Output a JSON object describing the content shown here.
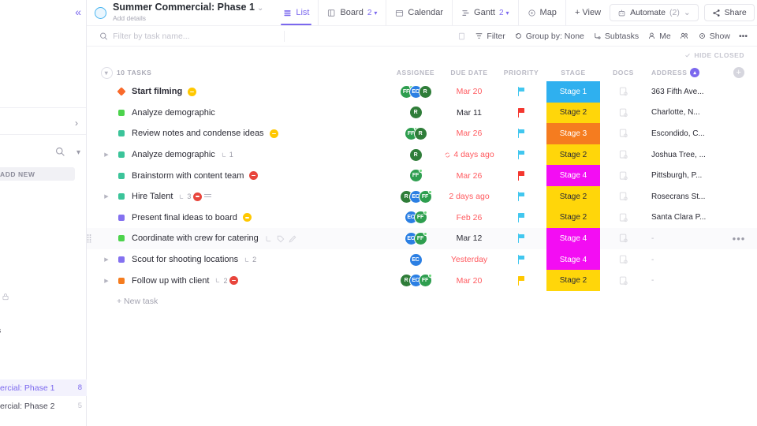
{
  "sidebar": {
    "collapse_icon": "double-chevron-left-icon",
    "expand_icon": "chevron-right-icon",
    "search_icon": "search-icon",
    "caret_icon": "chevron-down-icon",
    "add_new_label": "ADD NEW",
    "lock_icon": "lock-icon",
    "ghost_items": [
      {
        "label": "s"
      },
      {
        "label": "·"
      },
      {
        "label": "·"
      }
    ],
    "projects": [
      {
        "label": "ercial: Phase 1",
        "count": "8",
        "selected": true
      },
      {
        "label": "ercial: Phase 2",
        "count": "5",
        "selected": false
      }
    ]
  },
  "header": {
    "project_icon": "circle-outline-icon",
    "title": "Summer Commercial: Phase 1",
    "title_caret": "⌄",
    "subtitle": "Add details",
    "tabs": [
      {
        "label": "List",
        "icon": "list-icon",
        "count": "",
        "active": true
      },
      {
        "label": "Board",
        "icon": "board-icon",
        "count": "2",
        "active": false
      },
      {
        "label": "Calendar",
        "icon": "calendar-icon",
        "count": "",
        "active": false
      },
      {
        "label": "Gantt",
        "icon": "gantt-icon",
        "count": "2",
        "active": false
      },
      {
        "label": "Map",
        "icon": "map-pin-icon",
        "count": "",
        "active": false
      },
      {
        "label": "+ View",
        "icon": "plus-icon",
        "count": "",
        "active": false
      }
    ],
    "automate": {
      "label": "Automate",
      "count": "(2)",
      "icon": "robot-icon",
      "caret": "⌄"
    },
    "share": {
      "label": "Share",
      "icon": "share-icon"
    }
  },
  "filterbar": {
    "search_icon": "search-icon",
    "search_placeholder": "Filter by task name...",
    "search_value": "",
    "items": [
      {
        "label": "",
        "icon": "page-icon",
        "muted": true
      },
      {
        "label": "Filter",
        "icon": "filter-icon",
        "muted": false
      },
      {
        "label": "Group by: None",
        "icon": "group-icon",
        "muted": false
      },
      {
        "label": "Subtasks",
        "icon": "subtask-icon",
        "muted": false
      },
      {
        "label": "Me",
        "icon": "person-icon",
        "muted": false
      },
      {
        "label": "",
        "icon": "people-icon",
        "muted": false
      },
      {
        "label": "Show",
        "icon": "eye-icon",
        "muted": false
      },
      {
        "label": "•••",
        "icon": "more-icon",
        "muted": false
      }
    ],
    "hide_closed": {
      "label": "HIDE CLOSED",
      "icon": "check-icon"
    }
  },
  "table": {
    "group_caret_icon": "chevron-down-icon",
    "tasks_count_label": "10 TASKS",
    "columns": [
      {
        "key": "assignee",
        "label": "ASSIGNEE"
      },
      {
        "key": "due",
        "label": "DUE DATE"
      },
      {
        "key": "priority",
        "label": "PRIORITY"
      },
      {
        "key": "stage",
        "label": "STAGE"
      },
      {
        "key": "docs",
        "label": "DOCS"
      },
      {
        "key": "address",
        "label": "ADDRESS"
      }
    ],
    "address_chip_icon": "caret-up-icon",
    "add_column_icon": "plus-circle-icon",
    "new_task_label": "+ New task",
    "rows": [
      {
        "name": "Start filming",
        "bold": true,
        "dot_color": "#f96a2b",
        "dot_shape": "diamond",
        "expandable": false,
        "badges": [
          {
            "type": "yellow"
          }
        ],
        "subtask_count": "",
        "avatars": [
          {
            "initials": "FF",
            "color": "#2e9e4f",
            "online": true
          },
          {
            "initials": "EC",
            "color": "#2b7fe3",
            "online": false
          },
          {
            "initials": "R",
            "color": "#2f7d39",
            "online": false
          }
        ],
        "due": "Mar 20",
        "due_overdue": true,
        "due_recurring": false,
        "priority": "#42c7ef",
        "stage": "Stage 1",
        "stage_color": "#2fb0ef",
        "stage_text_dark": false,
        "address": "363 Fifth Ave...",
        "hovered": false
      },
      {
        "name": "Analyze demographic",
        "bold": false,
        "dot_color": "#4cd34c",
        "dot_shape": "square",
        "expandable": false,
        "badges": [],
        "subtask_count": "",
        "avatars": [
          {
            "initials": "R",
            "color": "#2f7d39",
            "online": false
          }
        ],
        "due": "Mar 11",
        "due_overdue": false,
        "due_recurring": false,
        "priority": "#f4372f",
        "stage": "Stage 2",
        "stage_color": "#ffd60a",
        "stage_text_dark": true,
        "address": "Charlotte, N...",
        "hovered": false
      },
      {
        "name": "Review notes and condense ideas",
        "bold": false,
        "dot_color": "#3cc49a",
        "dot_shape": "square",
        "expandable": false,
        "badges": [
          {
            "type": "yellow"
          }
        ],
        "subtask_count": "",
        "avatars": [
          {
            "initials": "FF",
            "color": "#2e9e4f",
            "online": true
          },
          {
            "initials": "R",
            "color": "#2f7d39",
            "online": false
          }
        ],
        "due": "Mar 26",
        "due_overdue": true,
        "due_recurring": false,
        "priority": "#42c7ef",
        "stage": "Stage 3",
        "stage_color": "#f57c1f",
        "stage_text_dark": false,
        "address": "Escondido, C...",
        "hovered": false
      },
      {
        "name": "Analyze demographic",
        "bold": false,
        "dot_color": "#3cc49a",
        "dot_shape": "square",
        "expandable": true,
        "badges": [],
        "subtask_count": "1",
        "avatars": [
          {
            "initials": "R",
            "color": "#2f7d39",
            "online": false
          }
        ],
        "due": "4 days ago",
        "due_overdue": true,
        "due_recurring": true,
        "priority": "#42c7ef",
        "stage": "Stage 2",
        "stage_color": "#ffd60a",
        "stage_text_dark": true,
        "address": "Joshua Tree, ...",
        "hovered": false
      },
      {
        "name": "Brainstorm with content team",
        "bold": false,
        "dot_color": "#3cc49a",
        "dot_shape": "square",
        "expandable": false,
        "badges": [
          {
            "type": "red"
          }
        ],
        "subtask_count": "",
        "avatars": [
          {
            "initials": "FF",
            "color": "#2e9e4f",
            "online": true
          }
        ],
        "due": "Mar 26",
        "due_overdue": true,
        "due_recurring": false,
        "priority": "#f4372f",
        "stage": "Stage 4",
        "stage_color": "#f30df3",
        "stage_text_dark": false,
        "address": "Pittsburgh, P...",
        "hovered": false
      },
      {
        "name": "Hire Talent",
        "bold": false,
        "dot_color": "#3cc49a",
        "dot_shape": "square",
        "expandable": true,
        "badges": [
          {
            "type": "red"
          },
          {
            "type": "lines"
          }
        ],
        "subtask_count": "3",
        "avatars": [
          {
            "initials": "R",
            "color": "#2f7d39",
            "online": false
          },
          {
            "initials": "EC",
            "color": "#2b7fe3",
            "online": false
          },
          {
            "initials": "FF",
            "color": "#2e9e4f",
            "online": true
          }
        ],
        "due": "2 days ago",
        "due_overdue": true,
        "due_recurring": false,
        "priority": "#42c7ef",
        "stage": "Stage 2",
        "stage_color": "#ffd60a",
        "stage_text_dark": true,
        "address": "Rosecrans St...",
        "hovered": false
      },
      {
        "name": "Present final ideas to board",
        "bold": false,
        "dot_color": "#8471f0",
        "dot_shape": "square",
        "expandable": false,
        "badges": [
          {
            "type": "yellow"
          }
        ],
        "subtask_count": "",
        "avatars": [
          {
            "initials": "EC",
            "color": "#2b7fe3",
            "online": false
          },
          {
            "initials": "FF",
            "color": "#2e9e4f",
            "online": true
          }
        ],
        "due": "Feb 26",
        "due_overdue": true,
        "due_recurring": false,
        "priority": "#42c7ef",
        "stage": "Stage 2",
        "stage_color": "#ffd60a",
        "stage_text_dark": true,
        "address": "Santa Clara P...",
        "hovered": false
      },
      {
        "name": "Coordinate with crew for catering",
        "bold": false,
        "dot_color": "#4cd34c",
        "dot_shape": "square",
        "expandable": false,
        "badges": [],
        "subtask_count": "",
        "hover_icons": [
          "subtask-icon",
          "tag-icon",
          "edit-icon"
        ],
        "avatars": [
          {
            "initials": "EC",
            "color": "#2b7fe3",
            "online": false
          },
          {
            "initials": "FF",
            "color": "#2e9e4f",
            "online": true
          }
        ],
        "due": "Mar 12",
        "due_overdue": false,
        "due_recurring": false,
        "priority": "#42c7ef",
        "stage": "Stage 4",
        "stage_color": "#f30df3",
        "stage_text_dark": false,
        "address": "-",
        "hovered": true,
        "row_more_icon": "more-horizontal-icon"
      },
      {
        "name": "Scout for shooting locations",
        "bold": false,
        "dot_color": "#8471f0",
        "dot_shape": "square",
        "expandable": true,
        "badges": [],
        "subtask_count": "2",
        "avatars": [
          {
            "initials": "EC",
            "color": "#2b7fe3",
            "online": false
          }
        ],
        "due": "Yesterday",
        "due_overdue": true,
        "due_recurring": false,
        "priority": "#42c7ef",
        "stage": "Stage 4",
        "stage_color": "#f30df3",
        "stage_text_dark": false,
        "address": "-",
        "hovered": false
      },
      {
        "name": "Follow up with client",
        "bold": false,
        "dot_color": "#f57c1f",
        "dot_shape": "square",
        "expandable": true,
        "badges": [
          {
            "type": "red"
          }
        ],
        "subtask_count": "2",
        "avatars": [
          {
            "initials": "R",
            "color": "#2f7d39",
            "online": false
          },
          {
            "initials": "EC",
            "color": "#2b7fe3",
            "online": false
          },
          {
            "initials": "FF",
            "color": "#2e9e4f",
            "online": true
          }
        ],
        "due": "Mar 20",
        "due_overdue": true,
        "due_recurring": false,
        "priority": "#ffc800",
        "stage": "Stage 2",
        "stage_color": "#ffd60a",
        "stage_text_dark": true,
        "address": "-",
        "hovered": false
      }
    ]
  },
  "colors": {
    "accent": "#7b68ee",
    "overdue": "#ff5a5f",
    "stage1": "#2fb0ef",
    "stage2": "#ffd60a",
    "stage3": "#f57c1f",
    "stage4": "#f30df3"
  }
}
